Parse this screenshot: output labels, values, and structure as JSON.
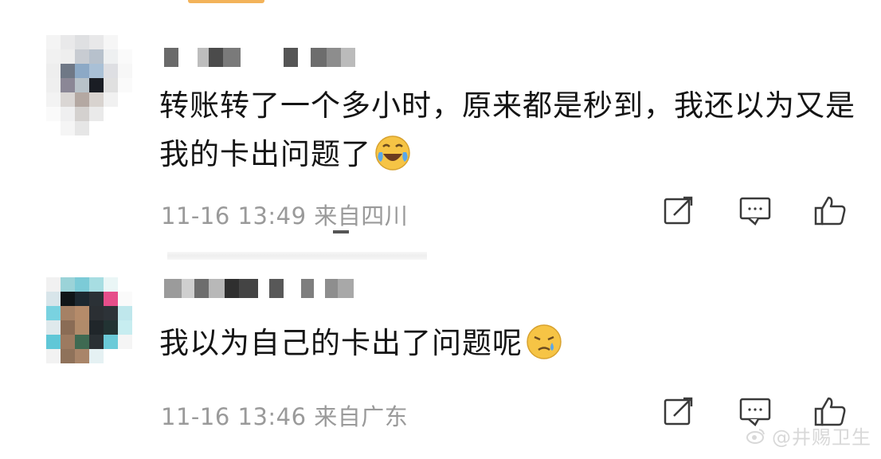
{
  "comments": [
    {
      "text": "转账转了一个多小时，原来都是秒到，我还以为又是我的卡出问题了",
      "emoji": "laugh-cry-emoji",
      "date": "11-16",
      "time": "13:49",
      "location": "来自四川"
    },
    {
      "text": "我以为自己的卡出了问题呢",
      "emoji": "sad-tear-emoji",
      "date": "11-16",
      "time": "13:46",
      "location": "来自广东"
    }
  ],
  "icons": {
    "share": "share-icon",
    "comment": "comment-icon",
    "like": "thumbs-up-icon"
  },
  "watermark": {
    "text": "@井赐卫生"
  },
  "colors": {
    "meta_text": "#9a9a9a",
    "body_text": "#141414",
    "icon_stroke": "#3a3a3a",
    "emoji_face": "#f6c445"
  }
}
